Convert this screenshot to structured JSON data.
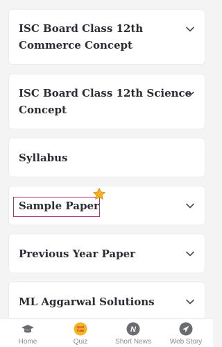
{
  "accordion": [
    {
      "label_line1": "ISC Board Class 12th",
      "label_line2": "Commerce Concept"
    },
    {
      "label_line1": "ISC Board Class 12th Science",
      "label_line2": "Concept"
    },
    {
      "label_line1": "Syllabus"
    },
    {
      "label_line1": "Sample Paper"
    },
    {
      "label_line1": "Previous Year Paper"
    },
    {
      "label_line1": "ML Aggarwal Solutions"
    }
  ],
  "bottom_nav": {
    "items": [
      {
        "label": "Home",
        "icon": "graduation-cap-icon"
      },
      {
        "label": "Quiz",
        "icon": "quiz-time-icon",
        "badge_text": "QUIZ TIME"
      },
      {
        "label": "Short News",
        "icon": "news-n-icon",
        "badge_text": "N"
      },
      {
        "label": "Web Story",
        "icon": "compass-arrow-icon"
      }
    ]
  },
  "colors": {
    "highlight_border": "#b0307a",
    "star": "#f2b01e",
    "text": "#2b2b33",
    "nav_label": "#8a8a92",
    "quiz_badge": "#f5b324"
  }
}
